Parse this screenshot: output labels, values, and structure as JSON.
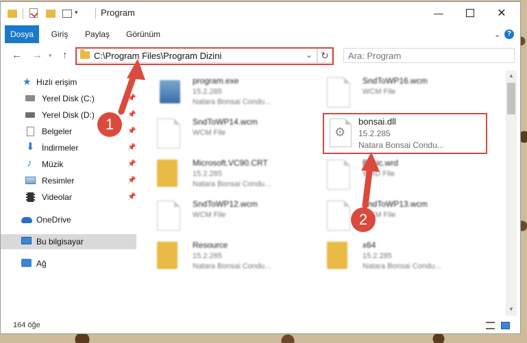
{
  "window": {
    "title": "Program"
  },
  "ribbon": {
    "tabs": [
      "Dosya",
      "Giriş",
      "Paylaş",
      "Görünüm"
    ],
    "help": "?"
  },
  "address": {
    "path": "C:\\Program Files\\Program Dizini",
    "search_placeholder": "Ara: Program"
  },
  "sidebar": {
    "items": [
      {
        "label": "Hızlı erişim"
      },
      {
        "label": "Yerel Disk (C:)"
      },
      {
        "label": "Yerel Disk (D:)"
      },
      {
        "label": "Belgeler"
      },
      {
        "label": "İndirmeler"
      },
      {
        "label": "Müzik"
      },
      {
        "label": "Resimler"
      },
      {
        "label": "Videolar"
      },
      {
        "label": "OneDrive"
      },
      {
        "label": "Bu bilgisayar"
      },
      {
        "label": "Ağ"
      }
    ]
  },
  "files": [
    {
      "name": "program.exe",
      "line2": "15.2.285",
      "line3": "Natara Bonsai Condu..."
    },
    {
      "name": "SndToWP16.wcm",
      "line2": "WCM File",
      "line3": ""
    },
    {
      "name": "SndToWP14.wcm",
      "line2": "WCM File",
      "line3": ""
    },
    {
      "name": "bonsai.dll",
      "line2": "15.2.285",
      "line3": "Natara Bonsai Condu..."
    },
    {
      "name": "Microsoft.VC90.CRT",
      "line2": "15.2.285",
      "line3": "Natara Bonsai Condu..."
    },
    {
      "name": "Basic.wrd",
      "line2": "WRD File",
      "line3": ""
    },
    {
      "name": "SndToWP12.wcm",
      "line2": "WCM File",
      "line3": ""
    },
    {
      "name": "SndToWP13.wcm",
      "line2": "WCM File",
      "line3": ""
    },
    {
      "name": "Resource",
      "line2": "15.2.285",
      "line3": "Natara Bonsai Condu..."
    },
    {
      "name": "x64",
      "line2": "15.2.285",
      "line3": "Natara Bonsai Condu..."
    }
  ],
  "status": {
    "count": "164 öğe"
  },
  "callouts": [
    "1",
    "2"
  ],
  "colors": {
    "accent": "#1979ca",
    "highlight": "#d8453e",
    "folder": "#e8b944"
  }
}
